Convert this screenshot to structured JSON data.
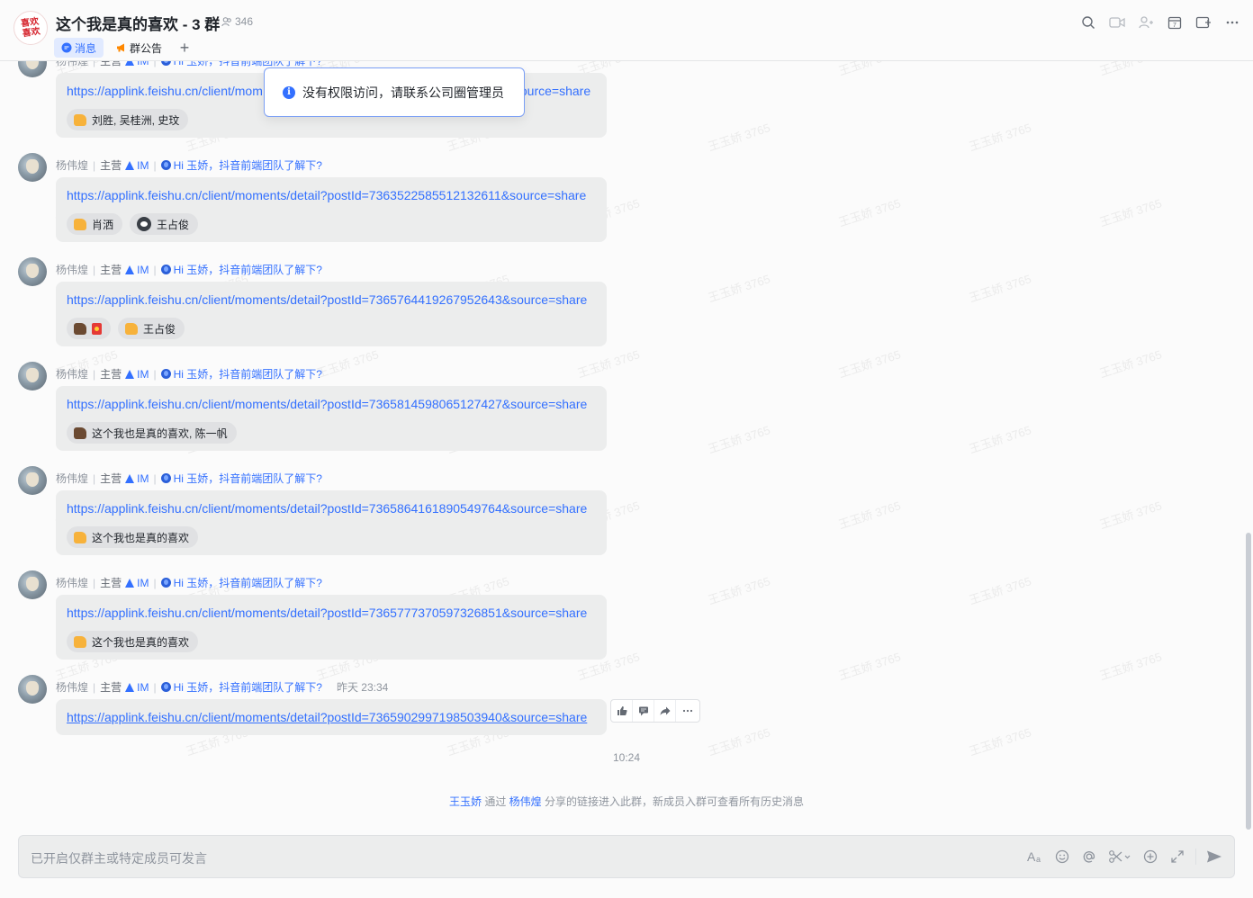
{
  "header": {
    "group_name": "这个我是真的喜欢 - 3 群",
    "member_count": "346",
    "avatar_text": "喜欢\n喜欢",
    "tabs": [
      {
        "label": "消息",
        "icon": "chat-bubble-icon"
      },
      {
        "label": "群公告",
        "icon": "megaphone-icon"
      }
    ],
    "tab_add": "+",
    "actions": [
      "search-icon",
      "video-call-icon",
      "add-member-icon",
      "calendar-icon",
      "add-widget-icon",
      "more-icon"
    ]
  },
  "toast": {
    "text": "没有权限访问，请联系公司圈管理员"
  },
  "messages": [
    {
      "sender": "杨伟煌",
      "role": "主营",
      "dept": "IM",
      "greeting": "Hi 玉娇，抖音前端团队了解下?",
      "link": "https://applink.feishu.cn/client/moments/detail?postId=7363522585512132611&source=share",
      "reactions": [
        {
          "emoji": "thumb",
          "users": "刘胜, 吴桂洲, 史玟"
        }
      ]
    },
    {
      "sender": "杨伟煌",
      "role": "主营",
      "dept": "IM",
      "greeting": "Hi 玉娇，抖音前端团队了解下?",
      "link": "https://applink.feishu.cn/client/moments/detail?postId=7363522585512132611&source=share",
      "reactions": [
        {
          "emoji": "thumb",
          "users": "肖洒"
        },
        {
          "emoji": "avatar",
          "users": "王占俊"
        }
      ]
    },
    {
      "sender": "杨伟煌",
      "role": "主营",
      "dept": "IM",
      "greeting": "Hi 玉娇，抖音前端团队了解下?",
      "link": "https://applink.feishu.cn/client/moments/detail?postId=7365764419267952643&source=share",
      "reactions": [
        {
          "emoji": "thumb-dark-redpacket",
          "users": ""
        },
        {
          "emoji": "thumb",
          "users": "王占俊"
        }
      ]
    },
    {
      "sender": "杨伟煌",
      "role": "主营",
      "dept": "IM",
      "greeting": "Hi 玉娇，抖音前端团队了解下?",
      "link": "https://applink.feishu.cn/client/moments/detail?postId=7365814598065127427&source=share",
      "reactions": [
        {
          "emoji": "thumb-dark",
          "users": "这个我也是真的喜欢, 陈一帆"
        }
      ]
    },
    {
      "sender": "杨伟煌",
      "role": "主营",
      "dept": "IM",
      "greeting": "Hi 玉娇，抖音前端团队了解下?",
      "link": "https://applink.feishu.cn/client/moments/detail?postId=7365864161890549764&source=share",
      "reactions": [
        {
          "emoji": "thumb",
          "users": "这个我也是真的喜欢"
        }
      ]
    },
    {
      "sender": "杨伟煌",
      "role": "主营",
      "dept": "IM",
      "greeting": "Hi 玉娇，抖音前端团队了解下?",
      "link": "https://applink.feishu.cn/client/moments/detail?postId=7365777370597326851&source=share",
      "reactions": [
        {
          "emoji": "thumb",
          "users": "这个我也是真的喜欢"
        }
      ]
    },
    {
      "sender": "杨伟煌",
      "role": "主营",
      "dept": "IM",
      "greeting": "Hi 玉娇，抖音前端团队了解下?",
      "time": "昨天 23:34",
      "link": "https://applink.feishu.cn/client/moments/detail?postId=7365902997198503940&source=share",
      "reactions": []
    }
  ],
  "first_message_link_visible_start": "https://applink.feishu.cn/client/mom",
  "first_message_link_visible_end": "ource=share",
  "message_actions": [
    "thumb-up-icon",
    "reply-icon",
    "forward-icon",
    "more-icon"
  ],
  "timestamp": "10:24",
  "system_note": {
    "user": "王玉娇",
    "via": "通过",
    "inviter": "杨伟煌",
    "rest": "分享的链接进入此群，新成员入群可查看所有历史消息"
  },
  "watermark": "王玉娇 3765",
  "input": {
    "placeholder": "已开启仅群主或特定成员可发言",
    "tools": [
      "format-icon",
      "emoji-icon",
      "mention-icon",
      "screenshot-icon",
      "add-icon",
      "expand-icon",
      "send-icon"
    ]
  },
  "colors": {
    "accent": "#3370ff",
    "bubble": "#eceded",
    "background": "#fbfbfb"
  }
}
